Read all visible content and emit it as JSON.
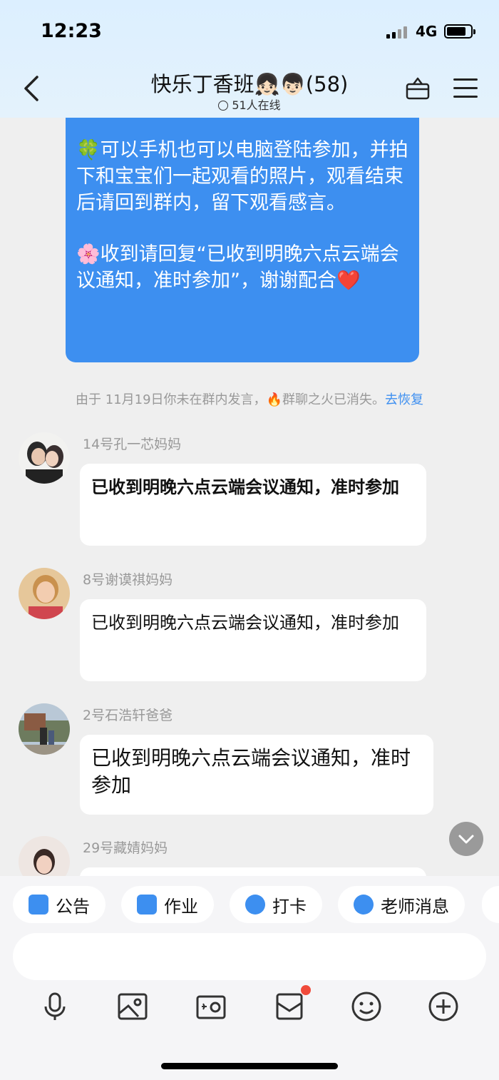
{
  "status_bar": {
    "time": "12:23",
    "network": "4G"
  },
  "header": {
    "title": "快乐丁香班👧🏻👦🏻(58)",
    "online": "51人在线"
  },
  "notice": {
    "p1": "🍀可以手机也可以电脑登陆参加，并拍下和宝宝们一起观看的照片，观看结束后请回到群内，留下观看感言。",
    "p2": "🌸收到请回复“已收到明晚六点云端会议通知，准时参加”，谢谢配合❤️"
  },
  "system_message": {
    "text": "由于 11月19日你未在群内发言，🔥群聊之火已消失。",
    "link": "去恢复"
  },
  "messages": [
    {
      "sender": "14号孔一芯妈妈",
      "text": "已收到明晚六点云端会议通知，准时参加"
    },
    {
      "sender": "8号谢谟祺妈妈",
      "text": "已收到明晚六点云端会议通知，准时参加"
    },
    {
      "sender": "2号石浩轩爸爸",
      "text": "已收到明晚六点云端会议通知，准时参加"
    },
    {
      "sender": "29号藏婧妈妈",
      "text": ""
    }
  ],
  "quick_actions": [
    {
      "label": "公告",
      "icon": "announcement-icon",
      "color": "#3d8ff0"
    },
    {
      "label": "作业",
      "icon": "homework-icon",
      "color": "#3d8ff0"
    },
    {
      "label": "打卡",
      "icon": "checkin-icon",
      "color": "#3d8ff0"
    },
    {
      "label": "老师消息",
      "icon": "teacher-icon",
      "color": "#3d8ff0"
    }
  ],
  "toolbar": [
    "microphone-icon",
    "image-icon",
    "camera-icon",
    "envelope-icon",
    "emoji-icon",
    "plus-icon"
  ],
  "colors": {
    "accent": "#3d8ff0",
    "badge": "#f04a3a",
    "header": "#dcefff"
  }
}
